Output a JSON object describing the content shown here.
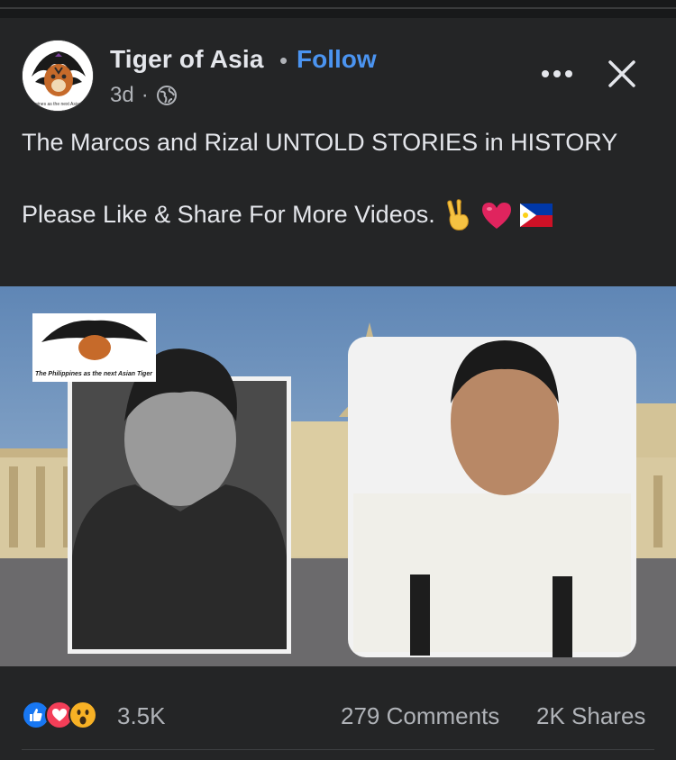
{
  "post": {
    "page_name": "Tiger of Asia",
    "separator": "•",
    "follow_label": "Follow",
    "time_ago": "3d",
    "meta_sep": "·",
    "audience_icon": "globe-icon",
    "avatar_text": "Philippines as the next Asian Tiger"
  },
  "caption": {
    "line1": "The Marcos and Rizal UNTOLD STORIES in HISTORY",
    "line2": "Please Like & Share For More Videos.",
    "emojis": [
      "victory-hand",
      "red-heart",
      "philippines-flag"
    ]
  },
  "media": {
    "logo_tagline": "The Philippines as the next Asian Tiger"
  },
  "footer": {
    "reaction_icons": [
      "like-icon",
      "love-icon",
      "wow-icon"
    ],
    "reaction_count": "3.5K",
    "comments": "279 Comments",
    "shares": "2K Shares"
  },
  "colors": {
    "background": "#242526",
    "text": "#e4e6eb",
    "muted": "#b0b3b8",
    "link": "#4b94f0",
    "like": "#1877f2",
    "love": "#f33e58",
    "wow": "#f7b125"
  }
}
